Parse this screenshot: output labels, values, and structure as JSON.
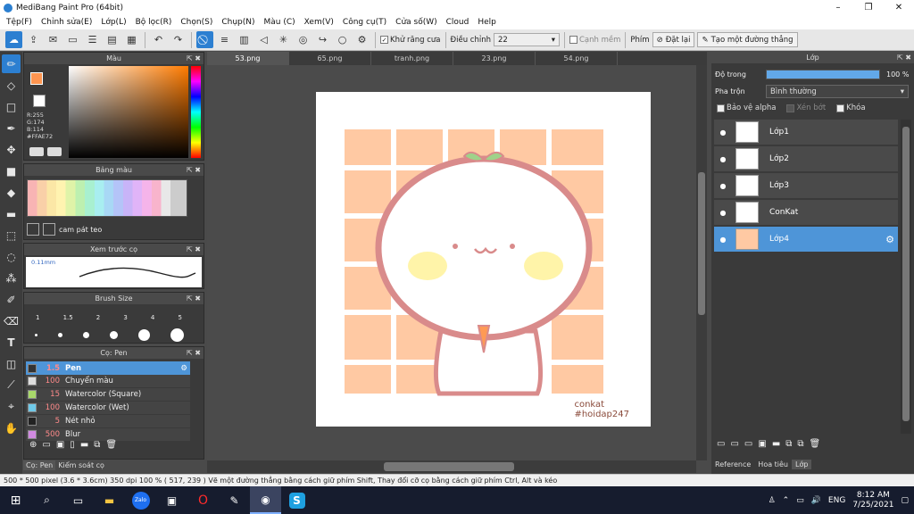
{
  "window": {
    "title": "MediBang Paint Pro (64bit)",
    "minimize": "–",
    "maximize": "❐",
    "close": "✕"
  },
  "menu": [
    "Tệp(F)",
    "Chỉnh sửa(E)",
    "Lớp(L)",
    "Bộ lọc(R)",
    "Chọn(S)",
    "Chụp(N)",
    "Màu (C)",
    "Xem(V)",
    "Công cụ(T)",
    "Cửa số(W)",
    "Cloud",
    "Help"
  ],
  "toolbar": {
    "antialias": "Khử răng cưa",
    "adjust_label": "Điều chỉnh",
    "adjust_value": "22",
    "edge": "Cạnh mềm",
    "key_label": "Phím",
    "reset": "Đặt lại",
    "new_line": "Tạo một đường thẳng"
  },
  "color_panel": {
    "title": "Màu",
    "r": "R:255",
    "g": "G:174",
    "b": "B:114",
    "hex": "#FFAE72",
    "accent": "#ff7b2f"
  },
  "palette_panel": {
    "title": "Bảng màu",
    "name": "cam pát teo"
  },
  "preview_panel": {
    "title": "Xem trước cọ",
    "size": "0.11mm"
  },
  "brush_size_panel": {
    "title": "Brush Size",
    "sizes": [
      "1",
      "1.5",
      "2",
      "3",
      "4",
      "5"
    ]
  },
  "brush_panel": {
    "title": "Cọ: Pen",
    "items": [
      {
        "size": "1.5",
        "name": "Pen",
        "color": "#333333"
      },
      {
        "size": "100",
        "name": "Chuyển màu",
        "color": "#dddddd"
      },
      {
        "size": "15",
        "name": "Watercolor (Square)",
        "color": "#a8d86a"
      },
      {
        "size": "100",
        "name": "Watercolor (Wet)",
        "color": "#6fc9e8"
      },
      {
        "size": "5",
        "name": "Nét nhỏ",
        "color": "#222222"
      },
      {
        "size": "500",
        "name": "Blur",
        "color": "#d08ae0"
      }
    ]
  },
  "bottom_tabs": {
    "brush": "Cọ: Pen",
    "materials": "Kiểm soát cọ"
  },
  "file_tabs": [
    "53.png",
    "65.png",
    "tranh.png",
    "23.png",
    "54.png"
  ],
  "artwork": {
    "signature_1": "conkat",
    "signature_2": "#hoidap247"
  },
  "layers_panel": {
    "title": "Lớp",
    "opacity_label": "Độ trong",
    "opacity_value": "100 %",
    "opacity": 1.0,
    "blend_label": "Pha trộn",
    "blend_value": "Bình thường",
    "protect_alpha": "Bảo vệ alpha",
    "clip": "Xén bớt",
    "lock": "Khóa",
    "layers": [
      "Lớp1",
      "Lớp2",
      "Lớp3",
      "ConKat",
      "Lớp4"
    ]
  },
  "right_tabs": [
    "Reference",
    "Hoa tiêu",
    "Lớp"
  ],
  "status": {
    "text": "500 * 500 pixel   (3.6 * 3.6cm)   350 dpi   100 %   ( 517, 239 )   Vẽ một đường thẳng bằng cách giữ phím Shift, Thay đổi cỡ cọ bằng cách giữ phím Ctrl, Alt và kéo"
  },
  "taskbar": {
    "lang": "ENG",
    "time": "8:12 AM",
    "date": "7/25/2021",
    "zalo": "Zalo",
    "skype": "S"
  }
}
